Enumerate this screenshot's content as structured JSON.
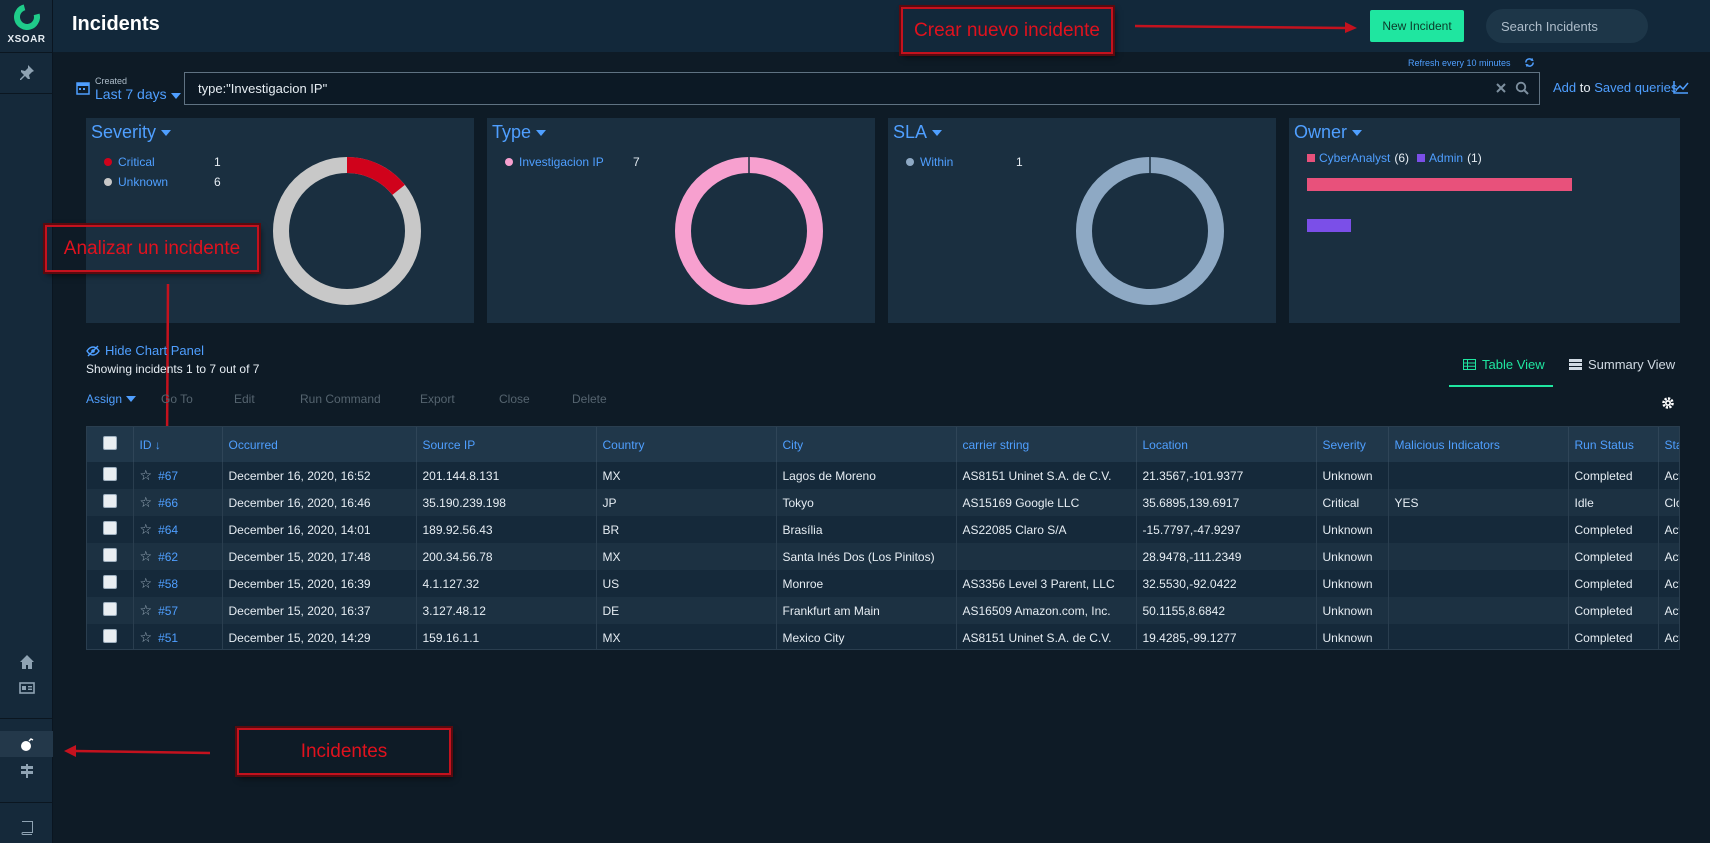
{
  "app": {
    "logo_text": "XSOAR",
    "page_title": "Incidents"
  },
  "header": {
    "new_incident_label": "New Incident",
    "search_placeholder": "Search Incidents",
    "help_label": "?"
  },
  "annotations": {
    "create": "Crear nuevo incidente",
    "analyze": "Analizar un incidente",
    "incidents": "Incidentes"
  },
  "query": {
    "created_label": "Created",
    "created_value": "Last 7 days",
    "refresh_text": "Refresh every 10 minutes",
    "query_text": "type:\"Investigacion IP\"",
    "add_label": "Add",
    "to_label": "to",
    "saved_queries_label": "Saved queries"
  },
  "widgets": {
    "severity": {
      "title": "Severity",
      "items": [
        {
          "label": "Critical",
          "count": "1",
          "color": "#d0021b"
        },
        {
          "label": "Unknown",
          "count": "6",
          "color": "#c8c8c8"
        }
      ]
    },
    "type": {
      "title": "Type",
      "items": [
        {
          "label": "Investigacion IP",
          "count": "7",
          "color": "#f7a0cf"
        }
      ]
    },
    "sla": {
      "title": "SLA",
      "items": [
        {
          "label": "Within",
          "count": "1",
          "color": "#8ea9c4"
        }
      ]
    },
    "owner": {
      "title": "Owner",
      "items": [
        {
          "label": "CyberAnalyst",
          "count": "(6)",
          "value": 6,
          "color": "#e8517b"
        },
        {
          "label": "Admin",
          "count": "(1)",
          "value": 1,
          "color": "#7b4fe8"
        }
      ]
    }
  },
  "controls": {
    "hide_chart_label": "Hide Chart Panel",
    "showing_text": "Showing incidents 1 to 7 out of 7",
    "table_view_label": "Table View",
    "summary_view_label": "Summary View",
    "toolbar": {
      "assign": "Assign",
      "goto": "Go To",
      "edit": "Edit",
      "run_command": "Run Command",
      "export": "Export",
      "close": "Close",
      "delete": "Delete"
    }
  },
  "table": {
    "headers": {
      "id": "ID ↓",
      "occurred": "Occurred",
      "source_ip": "Source IP",
      "country": "Country",
      "city": "City",
      "carrier": "carrier string",
      "location": "Location",
      "severity": "Severity",
      "malicious": "Malicious Indicators",
      "run_status": "Run Status",
      "status": "Status"
    },
    "rows": [
      {
        "id": "#67",
        "occurred": "December 16, 2020, 16:52",
        "source_ip": "201.144.8.131",
        "country": "MX",
        "city": "Lagos de Moreno",
        "carrier": "AS8151 Uninet S.A. de C.V.",
        "location": "21.3567,-101.9377",
        "severity": "Unknown",
        "malicious": "",
        "run_status": "Completed",
        "status": "Active"
      },
      {
        "id": "#66",
        "occurred": "December 16, 2020, 16:46",
        "source_ip": "35.190.239.198",
        "country": "JP",
        "city": "Tokyo",
        "carrier": "AS15169 Google LLC",
        "location": "35.6895,139.6917",
        "severity": "Critical",
        "malicious": "YES",
        "run_status": "Idle",
        "status": "Closed"
      },
      {
        "id": "#64",
        "occurred": "December 16, 2020, 14:01",
        "source_ip": "189.92.56.43",
        "country": "BR",
        "city": "Brasília",
        "carrier": "AS22085 Claro S/A",
        "location": "-15.7797,-47.9297",
        "severity": "Unknown",
        "malicious": "",
        "run_status": "Completed",
        "status": "Active"
      },
      {
        "id": "#62",
        "occurred": "December 15, 2020, 17:48",
        "source_ip": "200.34.56.78",
        "country": "MX",
        "city": "Santa Inés Dos (Los Pinitos)",
        "carrier": "",
        "location": "28.9478,-111.2349",
        "severity": "Unknown",
        "malicious": "",
        "run_status": "Completed",
        "status": "Active"
      },
      {
        "id": "#58",
        "occurred": "December 15, 2020, 16:39",
        "source_ip": "4.1.127.32",
        "country": "US",
        "city": "Monroe",
        "carrier": "AS3356 Level 3 Parent, LLC",
        "location": "32.5530,-92.0422",
        "severity": "Unknown",
        "malicious": "",
        "run_status": "Completed",
        "status": "Active"
      },
      {
        "id": "#57",
        "occurred": "December 15, 2020, 16:37",
        "source_ip": "3.127.48.12",
        "country": "DE",
        "city": "Frankfurt am Main",
        "carrier": "AS16509 Amazon.com, Inc.",
        "location": "50.1155,8.6842",
        "severity": "Unknown",
        "malicious": "",
        "run_status": "Completed",
        "status": "Active"
      },
      {
        "id": "#51",
        "occurred": "December 15, 2020, 14:29",
        "source_ip": "159.16.1.1",
        "country": "MX",
        "city": "Mexico City",
        "carrier": "AS8151 Uninet S.A. de C.V.",
        "location": "19.4285,-99.1277",
        "severity": "Unknown",
        "malicious": "",
        "run_status": "Completed",
        "status": "Active"
      }
    ]
  }
}
